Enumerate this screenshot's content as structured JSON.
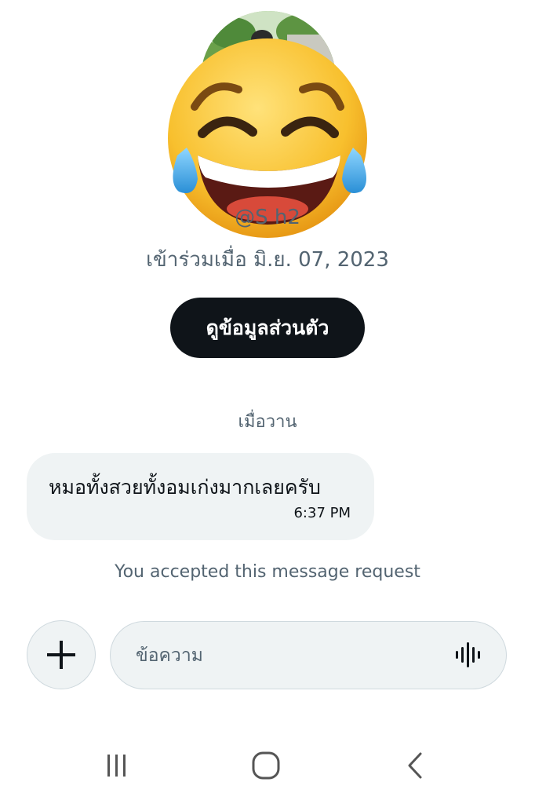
{
  "profile": {
    "handle": "@S          h2",
    "joined": "เข้าร่วมเมื่อ มิ.ย. 07, 2023",
    "view_profile_label": "ดูข้อมูลส่วนตัว"
  },
  "conversation": {
    "date_separator": "เมื่อวาน",
    "messages": [
      {
        "text": "หมอทั้งสวยทั้งอมเก่งมากเลยครับ",
        "time": "6:37 PM"
      }
    ],
    "accepted_note": "You accepted this message request"
  },
  "composer": {
    "placeholder": "ข้อความ",
    "add_icon": "plus-icon",
    "voice_icon": "voice-wave-icon"
  },
  "navbar": {
    "recent_icon": "recent-apps-icon",
    "home_icon": "home-icon",
    "back_icon": "back-icon"
  },
  "colors": {
    "primary_text": "#0f1419",
    "secondary_text": "#536471",
    "bubble_bg": "#eff3f4",
    "button_bg": "#0f1419",
    "emoji_yellow": "#f7b92a"
  }
}
